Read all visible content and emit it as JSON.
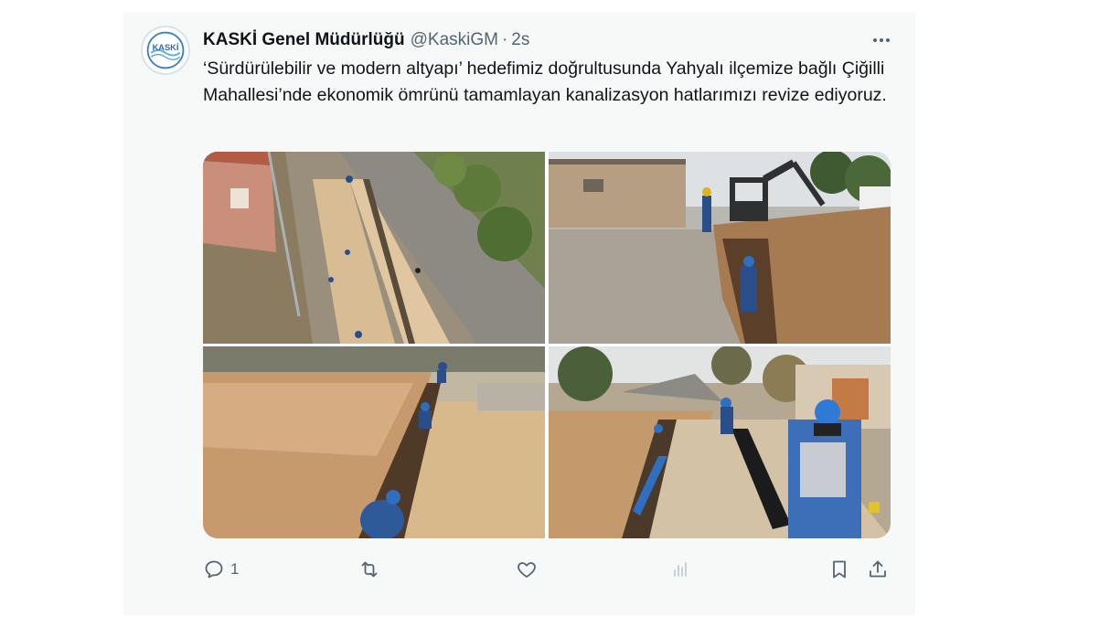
{
  "tweet": {
    "author_name": "KASKİ Genel Müdürlüğü",
    "handle": "@KaskiGM",
    "separator": "·",
    "time": "2s",
    "avatar_text": "KASKİ",
    "text": "‘Sürdürülebilir ve modern altyapı’ hedefimiz doğrultusunda Yahyalı ilçemize bağlı Çiğilli Mahallesi’nde ekonomik ömrünü tamamlayan kanalizasyon hatlarımızı revize ediyoruz.",
    "photos": [
      {
        "subject": "aerial view of excavated trench along village road"
      },
      {
        "subject": "excavator digging trench with workers"
      },
      {
        "subject": "workers in deep sandy trench"
      },
      {
        "subject": "worker guiding black sewer pipe into trench"
      }
    ],
    "actions": {
      "reply_count": "1",
      "icons": [
        "reply-icon",
        "retweet-icon",
        "like-icon",
        "views-icon",
        "bookmark-icon",
        "share-icon"
      ]
    },
    "colors": {
      "card_bg": "#f7f9f9",
      "text": "#0f1419",
      "secondary": "#536471",
      "avatar_blue": "#3b7fc4"
    }
  }
}
